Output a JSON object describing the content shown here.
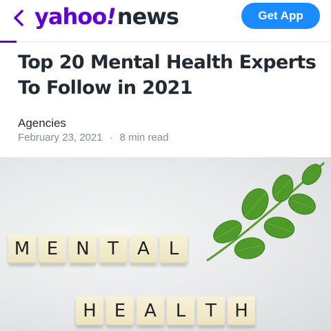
{
  "header": {
    "logo": {
      "part1": "yahoo",
      "part2": "!",
      "part3": "news"
    },
    "get_app_label": "Get App",
    "back_icon": "chevron-left-icon"
  },
  "article": {
    "title": "Top 20 Mental Health Experts To Follow in 2021",
    "author": "Agencies",
    "date": "February 23, 2021",
    "separator": "·",
    "read_time": "8 min read"
  },
  "hero_image": {
    "tiles_row1": [
      "M",
      "E",
      "N",
      "T",
      "A",
      "L"
    ],
    "tiles_row2": [
      "H",
      "E",
      "A",
      "L",
      "T",
      "H"
    ]
  },
  "colors": {
    "brand": "#6001d2",
    "button": "#1a8cff",
    "text": "#232a31",
    "muted": "#828c93"
  }
}
